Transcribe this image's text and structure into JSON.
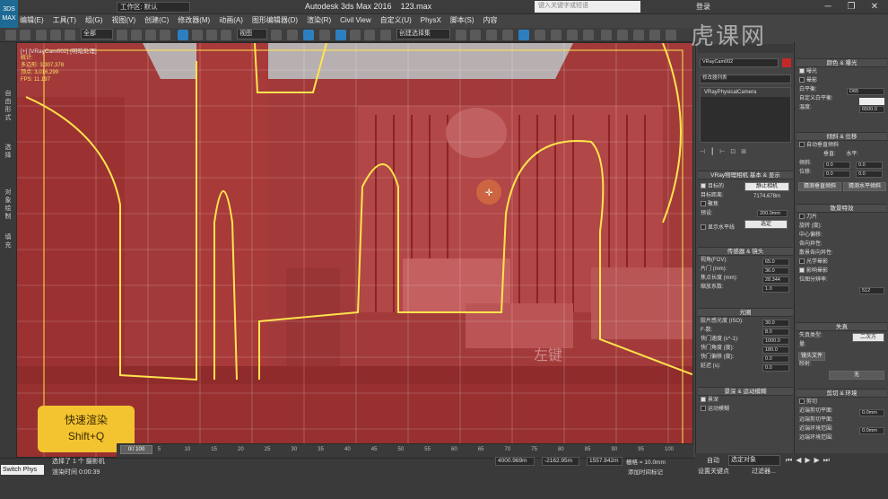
{
  "window": {
    "app_title": "Autodesk 3ds Max 2016",
    "file": "123.max",
    "workspace": "工作区: 默认",
    "search_placeholder": "键入关键字或短语",
    "login": "登录",
    "minimize": "─",
    "restore": "❐",
    "close": "✕",
    "logo": "3DS MAX"
  },
  "menu": [
    "编辑(E)",
    "工具(T)",
    "组(G)",
    "视图(V)",
    "创建(C)",
    "修改器(M)",
    "动画(A)",
    "图形编辑器(D)",
    "渲染(R)",
    "Civil View",
    "自定义(U)",
    "PhysX",
    "脚本(S)",
    "内容"
  ],
  "toolbar": {
    "selection_filter": "全部",
    "ref_coord": "视图",
    "named_selection": "创建选择集"
  },
  "left_tabs": [
    "自由形式",
    "选择",
    "对象绘制",
    "填充"
  ],
  "viewport": {
    "label": "[+] [VRayCam002] [明暗处理]",
    "stats_label": "统计:",
    "polys": "多边形: 3,307,378",
    "verts": "顶点: 3,016,299",
    "fps": "FPS: 11.197"
  },
  "overlay": {
    "shortcut_title": "快速渲染",
    "shortcut_keys": "Shift+Q",
    "click_hint": "左键"
  },
  "timeline": {
    "frame": "0 / 100",
    "ticks": [
      "0",
      "5",
      "10",
      "15",
      "20",
      "25",
      "30",
      "35",
      "40",
      "45",
      "50",
      "55",
      "60",
      "65",
      "70",
      "75",
      "80",
      "85",
      "90",
      "95",
      "100"
    ]
  },
  "status": {
    "switch": "Switch Phys",
    "selected": "选择了 1 个 摄影机",
    "render_time": "渲染时间 0:00:39",
    "x": "4000.969m",
    "y": "-2162.95m",
    "z": "1557.842m",
    "grid": "栅格 = 10.0mm",
    "add_time_tag": "添加时间标记",
    "auto": "自动",
    "set_key": "设置关键点",
    "key_filter": "过滤器...",
    "selected_obj": "选定对象"
  },
  "modify_panel": {
    "object_name": "VRayCam002",
    "modifier_list": "修改器列表",
    "stack_item": "VRayPhysicalCamera",
    "rollout_basic": "VRay物理相机 基本 & 显示",
    "target_label": "目标的",
    "target_type": "静止相机",
    "target_dist_label": "目标距离:",
    "target_dist": "7174.678m",
    "focus_label": "聚焦",
    "focus_val": "200.0mm",
    "preset_label": "预设:",
    "preset_val": "选定",
    "show_horizon": "显示水平线",
    "rollout_sensor": "传感器 & 镜头",
    "fov_label": "视角(FOV):",
    "fov": "65.0",
    "film_label": "片门 (mm):",
    "film": "36.0",
    "focal_label": "焦点长度 (mm):",
    "focal": "28.344",
    "zoom_label": "缩放系数:",
    "zoom": "1.0",
    "rollout_aperture": "光圈",
    "fnum_label": "胶片感光度 (ISO):",
    "fnum": "30.0",
    "f_label": "F-数:",
    "f": "8.0",
    "shutter_label": "快门速度 (s^-1):",
    "shutter": "1000.0",
    "shutter_angle_label": "快门角度 (度):",
    "shutter_angle": "180.0",
    "offset_label": "快门偏移 (度):",
    "offset": "0.0",
    "latency_label": "延迟 (s):",
    "latency": "0.0",
    "rollout_dof": "景深 & 运动模糊",
    "dof": "景深",
    "motion_blur": "运动模糊"
  },
  "right_panel": {
    "rollout_color": "颜色 & 曝光",
    "exposure": "曝光",
    "vignette": "晕影",
    "wb_label": "白平衡:",
    "wb_val": "D65",
    "custom_wb": "自定义白平衡:",
    "temp_label": "温度:",
    "temp_val": "6500.0",
    "rollout_tilt": "倾斜 & 位移",
    "auto_vert": "自动垂直倾斜",
    "vert_label": "垂直:",
    "horiz_label": "水平:",
    "tilt_label": "倾斜:",
    "shift_label": "位移:",
    "zero": "0.0",
    "guess_vert": "猜测垂直倾斜",
    "guess_horiz": "猜测水平倾斜",
    "rollout_bokeh": "散景特效",
    "blades": "刀片",
    "rotation_label": "旋转 (度):",
    "center_bias": "中心偏移:",
    "anisotropy": "各向异性:",
    "bokeh_aniso": "散景各向异性:",
    "optical_vig": "光学晕影",
    "vignetting_label": "影响晕影",
    "bitmap_res": "位图分辨率:",
    "bitmap_val": "512",
    "rollout_distortion": "失真",
    "dist_type_label": "失真类型:",
    "dist_type": "二次方",
    "amount_label": "量:",
    "map_label": "映射:",
    "none": "无",
    "lens_file": "镜头文件",
    "rollout_clip": "剪切 & 环境",
    "clip": "剪切",
    "near_clip": "近端剪切平面:",
    "far_clip": "远端剪切平面:",
    "near_env": "近端环境范围:",
    "far_env": "远端环境范围:",
    "zero_mm": "0.0mm"
  },
  "watermark": "虎课网"
}
